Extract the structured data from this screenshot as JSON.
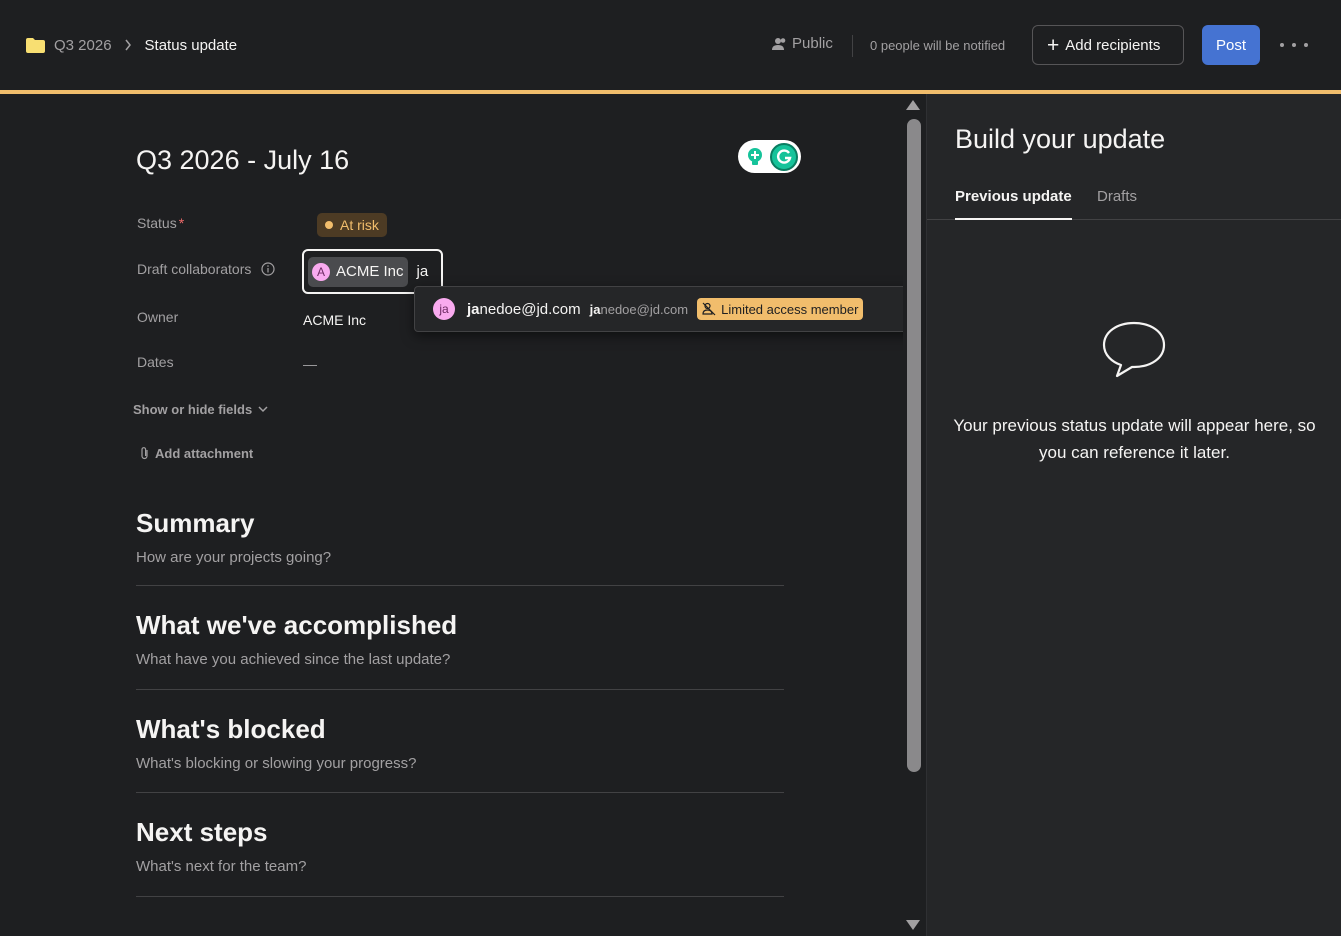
{
  "breadcrumb": {
    "parent": "Q3 2026",
    "current": "Status update"
  },
  "header": {
    "visibility": "Public",
    "notified": "0 people will be notified",
    "add_recipients": "Add recipients",
    "post": "Post"
  },
  "editor": {
    "title": "Q3 2026 - July 16",
    "fields": {
      "status_label": "Status",
      "status_required": "*",
      "status_value": "At risk",
      "collab_label": "Draft collaborators",
      "collab_token": "ACME Inc",
      "collab_token_initial": "A",
      "collab_typed": "ja",
      "owner_label": "Owner",
      "owner_value": "ACME Inc",
      "dates_label": "Dates",
      "dates_value": "—"
    },
    "suggestion": {
      "initials": "ja",
      "name_match": "ja",
      "name_rest": "nedoe@jd.com",
      "email_match": "ja",
      "email_rest": "nedoe@jd.com",
      "badge": "Limited access member"
    },
    "show_hide": "Show or hide fields",
    "add_attachment": "Add attachment",
    "sections": [
      {
        "heading": "Summary",
        "placeholder": "How are your projects going?"
      },
      {
        "heading": "What we've accomplished",
        "placeholder": "What have you achieved since the last update?"
      },
      {
        "heading": "What's blocked",
        "placeholder": "What's blocking or slowing your progress?"
      },
      {
        "heading": "Next steps",
        "placeholder": "What's next for the team?"
      }
    ]
  },
  "panel": {
    "title": "Build your update",
    "tabs": [
      "Previous update",
      "Drafts"
    ],
    "empty_text": "Your previous status update will appear here, so you can reference it later."
  },
  "colors": {
    "accent": "#f1bd6c",
    "primary": "#4573d2",
    "background": "#1e1f21",
    "panel": "#252628"
  }
}
